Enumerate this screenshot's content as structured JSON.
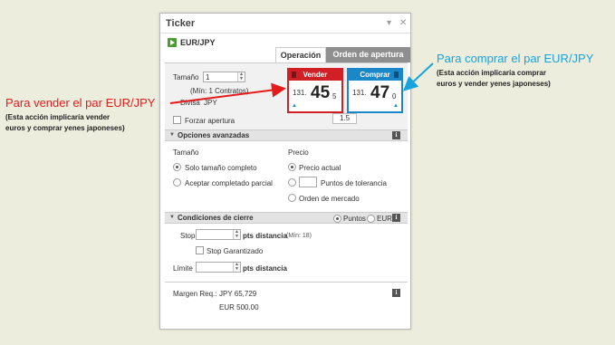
{
  "window": {
    "title": "Ticker"
  },
  "symbol": "EUR/JPY",
  "tabs": [
    {
      "label": "Operación"
    },
    {
      "label": "Orden de apertura"
    }
  ],
  "trade": {
    "size_label": "Tamaño",
    "size_value": "1",
    "min_contracts": "(Mín: 1 Contratos)",
    "currency_label": "Divisa",
    "currency_value": "JPY",
    "force_open_label": "Forzar apertura"
  },
  "sell": {
    "label": "Vender",
    "price_small": "131.",
    "price_big": "45",
    "price_tiny": "5"
  },
  "buy": {
    "label": "Comprar",
    "price_small": "131.",
    "price_big": "47",
    "price_tiny": "0"
  },
  "spread": "1.5",
  "advanced": {
    "title": "Opciones avanzadas",
    "size_title": "Tamaño",
    "size_options": [
      "Solo tamaño completo",
      "Aceptar completado parcial"
    ],
    "price_title": "Precio",
    "price_options": [
      "Precio actual",
      "Puntos de tolerancia",
      "Orden de mercado"
    ]
  },
  "close": {
    "title": "Condiciones de cierre",
    "units": [
      "Puntos",
      "EUR"
    ],
    "stop_label": "Stop",
    "stop_suffix": "pts distancia",
    "stop_min": "(Mín: 18)",
    "guaranteed_label": "Stop Garantizado",
    "limit_label": "Límite",
    "limit_suffix": "pts distancia"
  },
  "margin": {
    "label": "Margen Req.:",
    "jpy": "JPY 65,729",
    "eur": "EUR 500.00"
  },
  "annotations": {
    "sell_title": "Para vender el par EUR/JPY",
    "sell_note_1": "(Esta acción implicaría vender",
    "sell_note_2": "euros y comprar yenes japoneses)",
    "buy_title": "Para comprar el par EUR/JPY",
    "buy_note_1": "(Esta acción implicaría comprar",
    "buy_note_2": "euros y vender yenes japoneses)"
  },
  "colors": {
    "sell": "#d02025",
    "buy": "#1a87c9",
    "annotation_red": "#e31b1b",
    "annotation_blue": "#19a3dd"
  }
}
